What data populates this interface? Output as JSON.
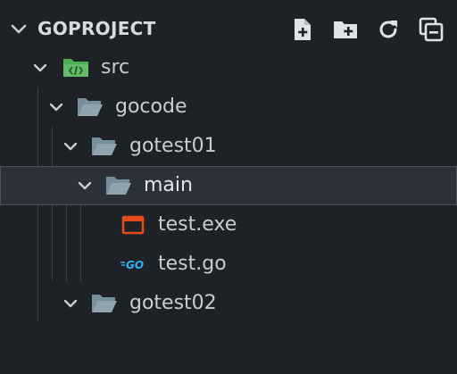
{
  "header": {
    "title": "GOPROJECT",
    "actions": [
      {
        "name": "new-file-icon"
      },
      {
        "name": "new-folder-icon"
      },
      {
        "name": "refresh-icon"
      },
      {
        "name": "collapse-all-icon"
      }
    ]
  },
  "tree": {
    "src": "src",
    "gocode": "gocode",
    "gotest01": "gotest01",
    "main": "main",
    "test_exe": "test.exe",
    "test_go": "test.go",
    "gotest02": "gotest02"
  },
  "colors": {
    "background": "#1e2227",
    "folder": "#90a4ae",
    "src_folder": "#4caf50",
    "exe_icon": "#e64a19",
    "go_icon": "#29b6f6"
  }
}
